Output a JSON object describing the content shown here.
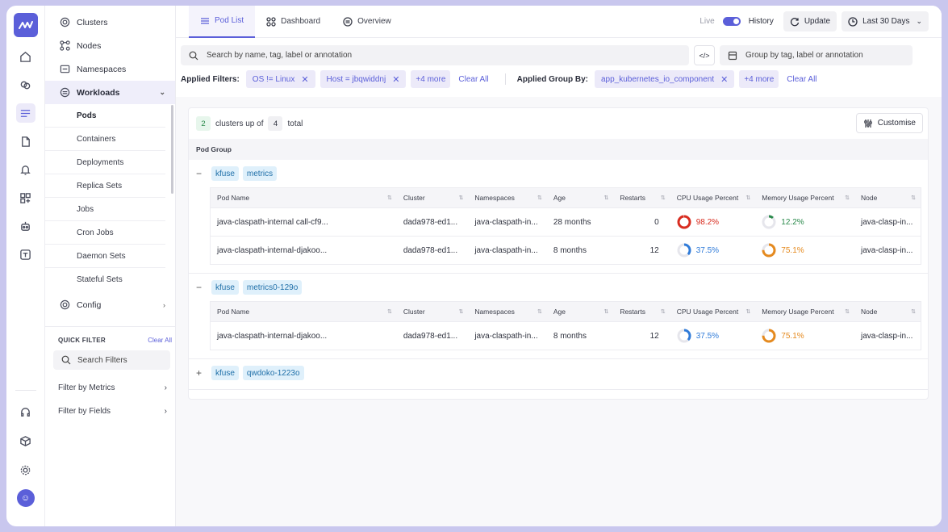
{
  "rail": {
    "top_icons": [
      "home-icon",
      "cloud-icon",
      "list-icon",
      "document-icon",
      "bell-icon",
      "widgets-icon",
      "robot-icon",
      "translate-icon"
    ],
    "bottom_icons": [
      "headset-icon",
      "cube-icon",
      "gear-icon"
    ],
    "avatar": "☺"
  },
  "sidebar": {
    "items": [
      {
        "label": "Clusters",
        "icon": "cluster-icon"
      },
      {
        "label": "Nodes",
        "icon": "nodes-icon"
      },
      {
        "label": "Namespaces",
        "icon": "namespace-icon"
      }
    ],
    "workloads": {
      "label": "Workloads",
      "icon": "workloads-icon"
    },
    "sub_items": [
      "Pods",
      "Containers",
      "Deployments",
      "Replica Sets",
      "Jobs",
      "Cron Jobs",
      "Daemon Sets",
      "Stateful Sets"
    ],
    "config": {
      "label": "Config",
      "icon": "config-icon"
    },
    "quick_filter": {
      "title": "QUICK FILTER",
      "clear": "Clear All",
      "search_placeholder": "Search Filters",
      "rows": [
        "Filter by Metrics",
        "Filter by Fields"
      ]
    }
  },
  "tabs": [
    "Pod List",
    "Dashboard",
    "Overview"
  ],
  "topbar": {
    "live": "Live",
    "history": "History",
    "update": "Update",
    "range": "Last 30 Days"
  },
  "filters": {
    "search_placeholder": "Search by name, tag, label or annotation",
    "code_label": "</>",
    "group_placeholder": "Group by tag, label or annotation",
    "applied_label": "Applied Filters:",
    "applied": [
      "OS != Linux",
      "Host = jbqwiddnj"
    ],
    "applied_more": "+4 more",
    "clear": "Clear All",
    "group_label": "Applied Group By:",
    "group_applied": [
      "app_kubernetes_io_component"
    ],
    "group_more": "+4 more",
    "group_clear": "Clear All"
  },
  "summary": {
    "shown": "2",
    "text1": "clusters up of",
    "total": "4",
    "text2": "total",
    "customise": "Customise"
  },
  "pod_group_header": "Pod Group",
  "columns": [
    "Pod Name",
    "Cluster",
    "Namespaces",
    "Age",
    "Restarts",
    "CPU Usage Percent",
    "Memory Usage Percent",
    "Node"
  ],
  "groups": [
    {
      "toggle": "−",
      "tags": [
        "kfuse",
        "metrics"
      ],
      "rows": [
        {
          "pod": "java-claspath-internal call-cf9...",
          "cluster": "dada978-ed1...",
          "ns": "java-claspath-in...",
          "age": "28 months",
          "restarts": "0",
          "cpu": "98.2%",
          "cpu_val": 98.2,
          "cpu_color": "#d92d20",
          "mem": "12.2%",
          "mem_val": 12.2,
          "mem_color": "#2b8a4c",
          "node": "java-clasp-in..."
        },
        {
          "pod": "java-claspath-internal-djakoo...",
          "cluster": "dada978-ed1...",
          "ns": "java-claspath-in...",
          "age": "8 months",
          "restarts": "12",
          "cpu": "37.5%",
          "cpu_val": 37.5,
          "cpu_color": "#2f7bd9",
          "mem": "75.1%",
          "mem_val": 75.1,
          "mem_color": "#e58a1f",
          "node": "java-clasp-in..."
        }
      ]
    },
    {
      "toggle": "−",
      "tags": [
        "kfuse",
        "metrics0-129o"
      ],
      "rows": [
        {
          "pod": "java-claspath-internal-djakoo...",
          "cluster": "dada978-ed1...",
          "ns": "java-claspath-in...",
          "age": "8 months",
          "restarts": "12",
          "cpu": "37.5%",
          "cpu_val": 37.5,
          "cpu_color": "#2f7bd9",
          "mem": "75.1%",
          "mem_val": 75.1,
          "mem_color": "#e58a1f",
          "node": "java-clasp-in..."
        }
      ]
    },
    {
      "toggle": "+",
      "tags": [
        "kfuse",
        "qwdoko-1223o"
      ],
      "rows": []
    }
  ]
}
